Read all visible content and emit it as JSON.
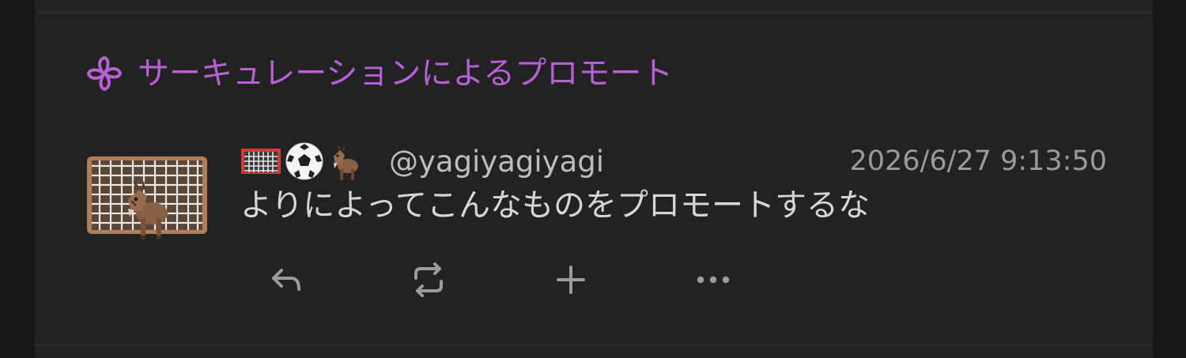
{
  "promotion": {
    "icon": "pinwheel-icon",
    "label": "サーキュレーションによるプロモート",
    "color": "#b760d6"
  },
  "note": {
    "avatar": "goalkeeper-goat-avatar",
    "display_name_emoji": [
      "goal-net-icon",
      "soccer-ball-icon",
      "goat-icon"
    ],
    "handle": "@yagiyagiyagi",
    "timestamp": "2026/6/27 9:13:50",
    "text": "よりによってこんなものをプロモートするな"
  },
  "actions": [
    {
      "name": "reply-icon"
    },
    {
      "name": "renote-icon"
    },
    {
      "name": "react-plus-icon"
    },
    {
      "name": "more-icon"
    }
  ]
}
